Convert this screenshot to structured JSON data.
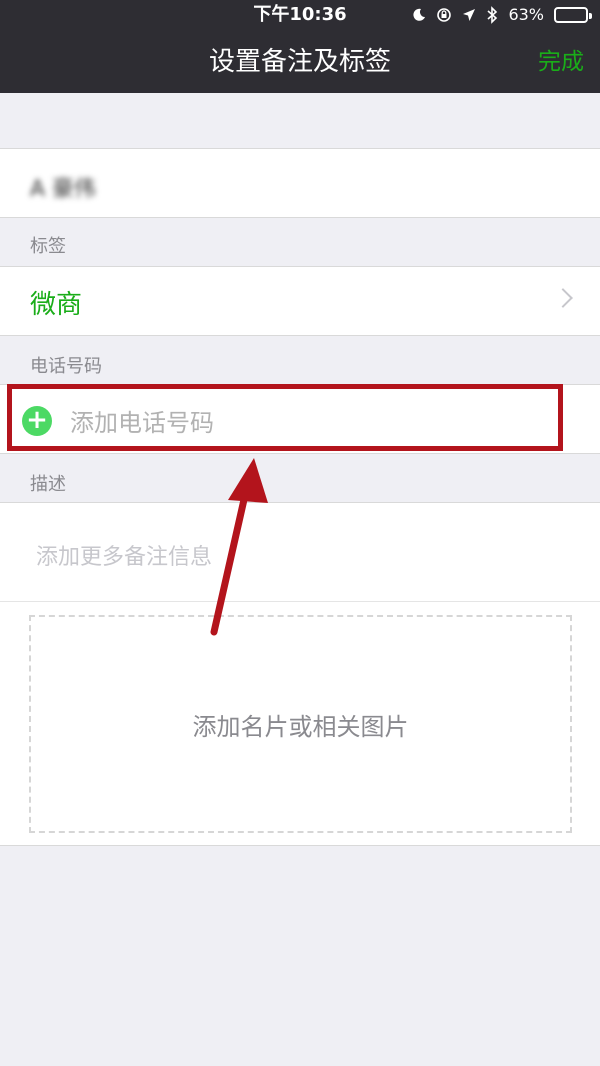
{
  "status_bar": {
    "time": "下午10:36",
    "battery_level": "63%",
    "icons": [
      "moon-icon",
      "rotation-lock-icon",
      "location-icon",
      "bluetooth-icon",
      "battery-icon"
    ]
  },
  "nav": {
    "title": "设置备注及标签",
    "done_label": "完成"
  },
  "remark": {
    "value": "A 豪伟"
  },
  "tags": {
    "label": "标签",
    "value": "微商"
  },
  "phone": {
    "label": "电话号码",
    "placeholder": "添加电话号码"
  },
  "description": {
    "label": "描述",
    "placeholder": "添加更多备注信息",
    "add_image": "添加名片或相关图片"
  },
  "colors": {
    "accent_green": "#1aad19",
    "add_icon_green": "#4cd964",
    "annotation_red": "#b3141c",
    "nav_background": "#2e2d33"
  }
}
